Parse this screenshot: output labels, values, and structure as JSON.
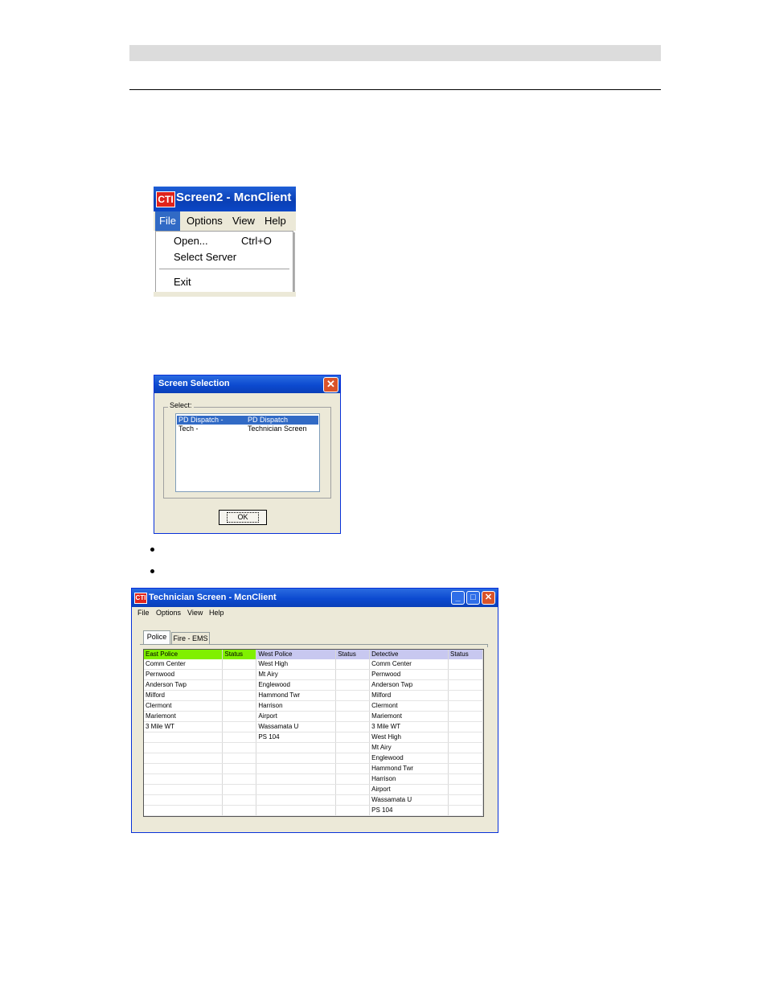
{
  "menu_shot": {
    "logo": "CTI",
    "title": "Screen2 - McnClient",
    "menubar": [
      "File",
      "Options",
      "View",
      "Help"
    ],
    "items": [
      {
        "label": "Open...",
        "shortcut": "Ctrl+O"
      },
      {
        "label": "Select Server",
        "shortcut": ""
      },
      {
        "label": "Exit",
        "shortcut": ""
      }
    ]
  },
  "selection_dialog": {
    "title": "Screen Selection",
    "group_label": "Select:",
    "rows": [
      {
        "name": "PD Dispatch -",
        "desc": "PD Dispatch",
        "selected": true
      },
      {
        "name": "Tech -",
        "desc": "Technician Screen",
        "selected": false
      }
    ],
    "ok_label": "OK"
  },
  "tech_window": {
    "logo": "CTI",
    "title": "Technician Screen - McnClient",
    "menus": [
      "File",
      "Options",
      "View",
      "Help"
    ],
    "tabs": [
      "Police",
      "Fire - EMS"
    ],
    "columns": [
      {
        "label": "East Police",
        "color": "#80f000"
      },
      {
        "label": "Status",
        "color": "#80f000"
      },
      {
        "label": "West Police",
        "color": "#c8c8f0"
      },
      {
        "label": "Status",
        "color": "#c8c8f0"
      },
      {
        "label": "Detective",
        "color": "#c8c8f0"
      },
      {
        "label": "Status",
        "color": "#c8c8f0"
      }
    ],
    "rows": [
      [
        "Comm Center",
        "",
        "West High",
        "",
        "Comm Center",
        ""
      ],
      [
        "Pernwood",
        "",
        "Mt Airy",
        "",
        "Pernwood",
        ""
      ],
      [
        "Anderson Twp",
        "",
        "Englewood",
        "",
        "Anderson Twp",
        ""
      ],
      [
        "Milford",
        "",
        "Hammond Twr",
        "",
        "Milford",
        ""
      ],
      [
        "Clermont",
        "",
        "Harrison",
        "",
        "Clermont",
        ""
      ],
      [
        "Mariemont",
        "",
        "Airport",
        "",
        "Mariemont",
        ""
      ],
      [
        "3 Mile WT",
        "",
        "Wassamata U",
        "",
        "3 Mile WT",
        ""
      ],
      [
        "",
        "",
        "PS 104",
        "",
        "West High",
        ""
      ],
      [
        "",
        "",
        "",
        "",
        "Mt Airy",
        ""
      ],
      [
        "",
        "",
        "",
        "",
        "Englewood",
        ""
      ],
      [
        "",
        "",
        "",
        "",
        "Hammond Twr",
        ""
      ],
      [
        "",
        "",
        "",
        "",
        "Harrison",
        ""
      ],
      [
        "",
        "",
        "",
        "",
        "Airport",
        ""
      ],
      [
        "",
        "",
        "",
        "",
        "Wassamata U",
        ""
      ],
      [
        "",
        "",
        "",
        "",
        "PS 104",
        ""
      ]
    ]
  }
}
